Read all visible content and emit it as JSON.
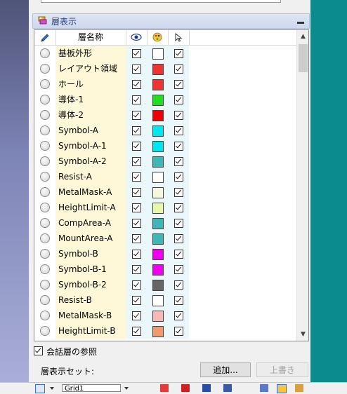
{
  "panel": {
    "title": "層表示"
  },
  "columns": {
    "name": "層名称"
  },
  "layers": [
    {
      "name": "基板外形",
      "visible": true,
      "color": "#ffffff",
      "selectable": true
    },
    {
      "name": "レイアウト領域",
      "visible": true,
      "color": "#ee3333",
      "selectable": true
    },
    {
      "name": "ホール",
      "visible": true,
      "color": "#ee3333",
      "selectable": true
    },
    {
      "name": "導体-1",
      "visible": true,
      "color": "#22dd22",
      "selectable": true
    },
    {
      "name": "導体-2",
      "visible": true,
      "color": "#ee0000",
      "selectable": true
    },
    {
      "name": "Symbol-A",
      "visible": true,
      "color": "#00e5ee",
      "selectable": true
    },
    {
      "name": "Symbol-A-1",
      "visible": true,
      "color": "#00e5ee",
      "selectable": true
    },
    {
      "name": "Symbol-A-2",
      "visible": true,
      "color": "#3fb5b5",
      "selectable": true
    },
    {
      "name": "Resist-A",
      "visible": true,
      "color": "#ffffff",
      "selectable": true
    },
    {
      "name": "MetalMask-A",
      "visible": true,
      "color": "#f4f8dc",
      "selectable": true
    },
    {
      "name": "HeightLimit-A",
      "visible": true,
      "color": "#e8f8a8",
      "selectable": true
    },
    {
      "name": "CompArea-A",
      "visible": true,
      "color": "#3fb5b5",
      "selectable": true
    },
    {
      "name": "MountArea-A",
      "visible": true,
      "color": "#3fb5b5",
      "selectable": true
    },
    {
      "name": "Symbol-B",
      "visible": true,
      "color": "#ee00ee",
      "selectable": true
    },
    {
      "name": "Symbol-B-1",
      "visible": true,
      "color": "#ee00ee",
      "selectable": true
    },
    {
      "name": "Symbol-B-2",
      "visible": true,
      "color": "#666666",
      "selectable": true
    },
    {
      "name": "Resist-B",
      "visible": true,
      "color": "#ffffff",
      "selectable": true
    },
    {
      "name": "MetalMask-B",
      "visible": true,
      "color": "#f6b8b8",
      "selectable": true
    },
    {
      "name": "HeightLimit-B",
      "visible": true,
      "color": "#f09a70",
      "selectable": true
    }
  ],
  "reference_option": {
    "label": "会話層の参照",
    "checked": true
  },
  "display_set": {
    "label": "層表示セット:",
    "add_button": "追加...",
    "overwrite_button": "上書き"
  },
  "toolbar": {
    "grid_select": "Grid1"
  },
  "colors": {
    "accent_title": "#2a3f7a",
    "name_bg": "#fff8d8",
    "vis_bg": "#eaf7fb",
    "side": "#0b8b8b"
  }
}
